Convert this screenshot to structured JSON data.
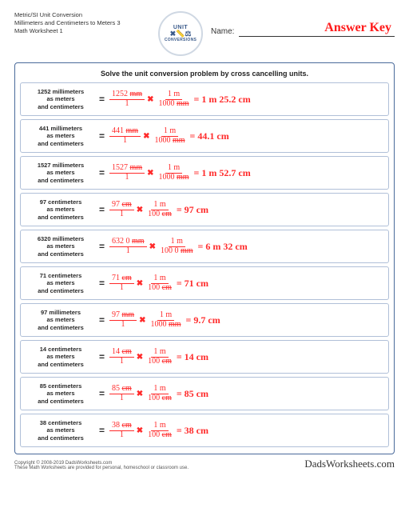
{
  "header": {
    "line1": "Metric/SI Unit Conversion",
    "line2": "Millimeters and Centimeters to Meters 3",
    "line3": "Math Worksheet 1",
    "name_label": "Name:",
    "answer_key": "Answer Key"
  },
  "logo": {
    "top": "UNIT",
    "bottom": "CONVERSIONS",
    "icons": "✖📏⚖"
  },
  "instruction": "Solve the unit conversion problem by cross cancelling units.",
  "problems": [
    {
      "qv": "1252",
      "qu": "millimeters",
      "n1": "1252 mm",
      "d1": "1",
      "n2": "1 m",
      "d2": "1000 mm",
      "res": "= 1 m 25.2 cm"
    },
    {
      "qv": "441",
      "qu": "millimeters",
      "n1": "441 mm",
      "d1": "1",
      "n2": "1 m",
      "d2": "1000 mm",
      "res": "= 44.1 cm"
    },
    {
      "qv": "1527",
      "qu": "millimeters",
      "n1": "1527 mm",
      "d1": "1",
      "n2": "1 m",
      "d2": "1000 mm",
      "res": "= 1 m 52.7 cm"
    },
    {
      "qv": "97",
      "qu": "centimeters",
      "n1": "97 cm",
      "d1": "1",
      "n2": "1 m",
      "d2": "100 cm",
      "res": "= 97 cm"
    },
    {
      "qv": "6320",
      "qu": "millimeters",
      "n1": "632 0 mm",
      "d1": "1",
      "n2": "1 m",
      "d2": "100 0 mm",
      "res": "= 6 m 32 cm"
    },
    {
      "qv": "71",
      "qu": "centimeters",
      "n1": "71 cm",
      "d1": "1",
      "n2": "1 m",
      "d2": "100 cm",
      "res": "= 71 cm"
    },
    {
      "qv": "97",
      "qu": "millimeters",
      "n1": "97 mm",
      "d1": "1",
      "n2": "1 m",
      "d2": "1000 mm",
      "res": "= 9.7 cm"
    },
    {
      "qv": "14",
      "qu": "centimeters",
      "n1": "14 cm",
      "d1": "1",
      "n2": "1 m",
      "d2": "100 cm",
      "res": "= 14 cm"
    },
    {
      "qv": "85",
      "qu": "centimeters",
      "n1": "85 cm",
      "d1": "1",
      "n2": "1 m",
      "d2": "100 cm",
      "res": "= 85 cm"
    },
    {
      "qv": "38",
      "qu": "centimeters",
      "n1": "38 cm",
      "d1": "1",
      "n2": "1 m",
      "d2": "100 cm",
      "res": "= 38 cm"
    }
  ],
  "question_sub1": "as meters",
  "question_sub2": "and centimeters",
  "mul": "✖",
  "footer": {
    "copy": "Copyright © 2008-2019 DadsWorksheets.com",
    "note": "These Math Worksheets are provided for personal, homeschool or classroom use.",
    "brand": "DadsWorksheets.com"
  }
}
